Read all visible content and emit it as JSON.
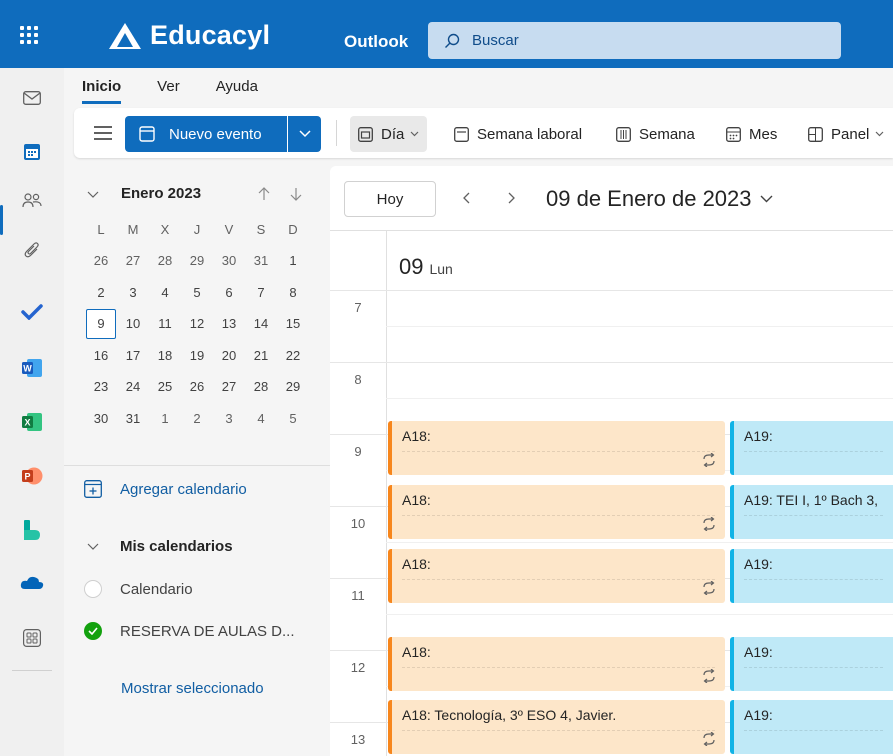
{
  "header": {
    "brand": "Educacyl",
    "app_name": "Outlook",
    "search_placeholder": "Buscar",
    "colors": {
      "topbar": "#0f6cbd",
      "search_bg": "#c7dcf0"
    }
  },
  "rail": {
    "items": [
      "mail-icon",
      "calendar-icon",
      "people-icon",
      "attach-icon",
      "todo-icon",
      "word-icon",
      "excel-icon",
      "powerpoint-icon",
      "bookings-icon",
      "onedrive-icon",
      "more-apps-icon"
    ],
    "active": "calendar-icon"
  },
  "ribbon": {
    "tabs": [
      "Inicio",
      "Ver",
      "Ayuda"
    ],
    "active_tab": "Inicio",
    "new_event_label": "Nuevo evento",
    "views": [
      "Día",
      "Semana laboral",
      "Semana",
      "Mes",
      "Panel"
    ],
    "active_view": "Día"
  },
  "mini_calendar": {
    "month_label": "Enero 2023",
    "weekdays": [
      "L",
      "M",
      "X",
      "J",
      "V",
      "S",
      "D"
    ],
    "weeks": [
      [
        "26",
        "27",
        "28",
        "29",
        "30",
        "31",
        "1"
      ],
      [
        "2",
        "3",
        "4",
        "5",
        "6",
        "7",
        "8"
      ],
      [
        "9",
        "10",
        "11",
        "12",
        "13",
        "14",
        "15"
      ],
      [
        "16",
        "17",
        "18",
        "19",
        "20",
        "21",
        "22"
      ],
      [
        "23",
        "24",
        "25",
        "26",
        "27",
        "28",
        "29"
      ],
      [
        "30",
        "31",
        "1",
        "2",
        "3",
        "4",
        "5"
      ]
    ],
    "today": "9"
  },
  "sidebar": {
    "add_calendar": "Agregar calendario",
    "my_calendars": "Mis calendarios",
    "calendars": [
      {
        "name": "Calendario",
        "checked": false
      },
      {
        "name": "RESERVA DE AULAS D...",
        "checked": true,
        "color": "#13a10e"
      }
    ],
    "show_selected": "Mostrar seleccionado"
  },
  "calendar": {
    "today_button": "Hoy",
    "date_title": "09 de Enero de 2023",
    "day_number": "09",
    "day_name": "Lun",
    "hours": [
      "7",
      "8",
      "9",
      "10",
      "11",
      "12",
      "13"
    ],
    "events_orange": [
      {
        "title": "A18:"
      },
      {
        "title": "A18:"
      },
      {
        "title": "A18:"
      },
      {
        "title": "A18:"
      },
      {
        "title": "A18: Tecnología, 3º ESO 4, Javier."
      }
    ],
    "events_blue": [
      {
        "title": "A19:"
      },
      {
        "title": "A19: TEI I, 1º Bach 3,"
      },
      {
        "title": "A19:"
      },
      {
        "title": "A19:"
      },
      {
        "title": "A19:"
      }
    ],
    "colors": {
      "orange_bg": "#fde6c9",
      "orange_bar": "#f7861c",
      "blue_bg": "#bfe9f7",
      "blue_bar": "#11b3e6"
    }
  }
}
